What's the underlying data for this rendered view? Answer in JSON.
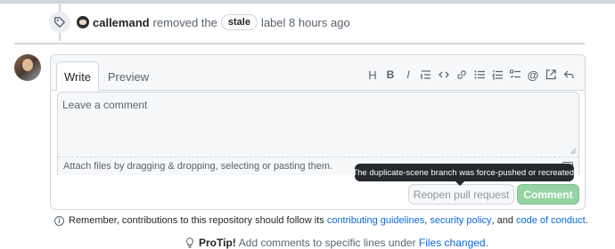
{
  "timeline_event": {
    "user": "callemand",
    "action": "removed the",
    "label": "stale",
    "suffix": "label 8 hours ago"
  },
  "editor": {
    "tabs": [
      "Write",
      "Preview"
    ],
    "toolbar": {
      "heading": "H",
      "bold": "B",
      "italic": "I",
      "quote": "quote-icon",
      "code": "code-icon",
      "link": "link-icon",
      "unordered_list": "unordered-list-icon",
      "ordered_list": "ordered-list-icon",
      "task_list": "task-list-icon",
      "mention": "@",
      "reference": "cross-reference-icon",
      "reply": "reply-icon"
    },
    "placeholder": "Leave a comment",
    "value": "",
    "attach_hint": "Attach files by dragging & dropping, selecting or pasting them."
  },
  "tooltip": "The duplicate-scene branch was force-pushed or recreated.",
  "buttons": {
    "reopen": "Reopen pull request",
    "comment": "Comment"
  },
  "guidelines": {
    "prefix": "Remember, contributions to this repository should follow its",
    "link1": "contributing guidelines",
    "sep1": ",",
    "link2": "security policy",
    "sep2": ", and",
    "link3": "code of conduct",
    "end": "."
  },
  "protip": {
    "label": "ProTip!",
    "text": "Add comments to specific lines under",
    "link": "Files changed",
    "end": "."
  },
  "colors": {
    "accent": "#0969da",
    "comment_button": "#94d3a2",
    "tooltip_bg": "#25292e",
    "border": "#d0d7de"
  }
}
